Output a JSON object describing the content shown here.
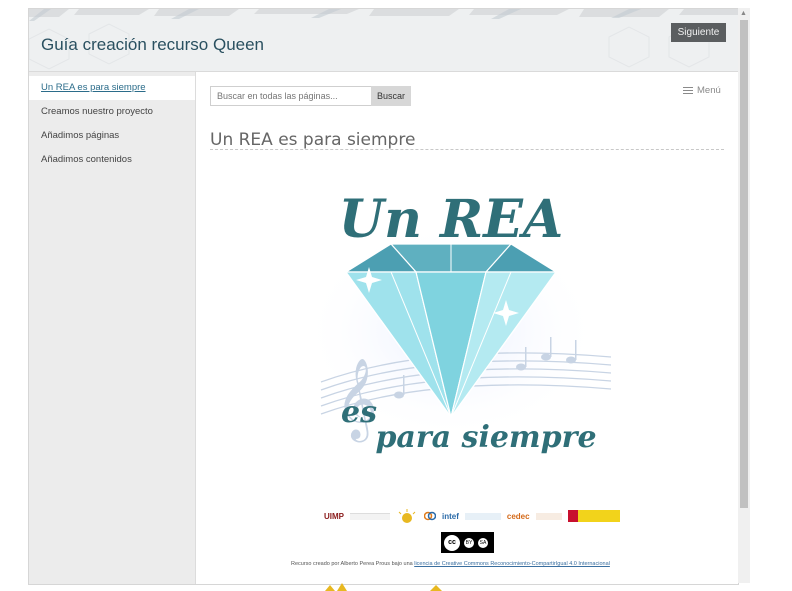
{
  "header": {
    "site_title": "Guía creación recurso Queen",
    "next_button": "Siguiente"
  },
  "sidebar": {
    "items": [
      {
        "label": "Un REA es para siempre",
        "active": true
      },
      {
        "label": "Creamos nuestro proyecto",
        "active": false
      },
      {
        "label": "Añadimos páginas",
        "active": false
      },
      {
        "label": "Añadimos contenidos",
        "active": false
      }
    ]
  },
  "search": {
    "placeholder": "Buscar en todas las páginas...",
    "button": "Buscar"
  },
  "menu": {
    "label": "Menú"
  },
  "page": {
    "title": "Un REA es para siempre"
  },
  "hero": {
    "line1": "Un REA",
    "line2": "es",
    "line3": "para siempre"
  },
  "sponsors": [
    {
      "name": "UIMP",
      "color": "#8a1a1a"
    },
    {
      "name": "intef",
      "color": "#2a6aa8"
    },
    {
      "name": "cedec",
      "color": "#d46a1a"
    }
  ],
  "license_badge": {
    "cc": "cc",
    "by": "BY",
    "sa": "SA"
  },
  "credit": {
    "prefix": "Recurso creado por Alberto Perea Prous bajo una ",
    "link": "licencia de Creative Commons Reconocimiento-CompartirIgual 4.0 Internacional"
  },
  "colors": {
    "title": "#2a5060",
    "hero_text": "#2f6f78",
    "diamond": "#7fd3df",
    "link": "#2b6c8a"
  }
}
